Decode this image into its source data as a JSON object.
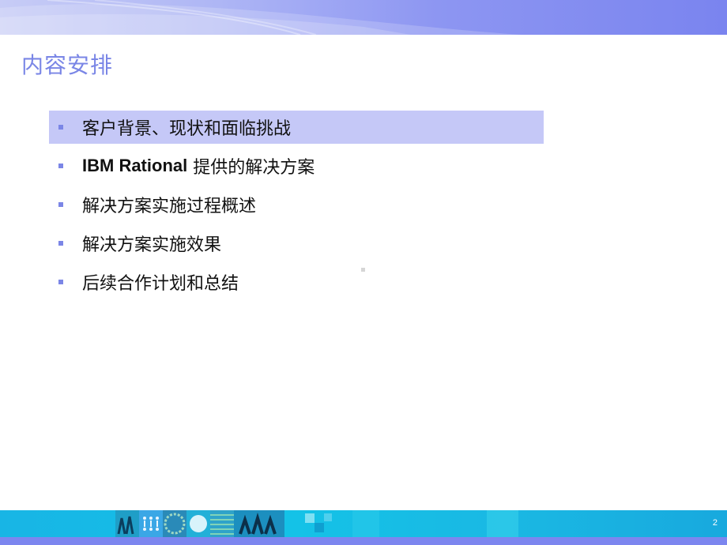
{
  "slide": {
    "title": "内容安排",
    "page_number": "2"
  },
  "agenda": {
    "items": [
      {
        "label": "客户背景、现状和面临挑战"
      },
      {
        "prefix": "IBM Rational",
        "label": " 提供的解决方案"
      },
      {
        "label": "解决方案实施过程概述"
      },
      {
        "label": "解决方案实施效果"
      },
      {
        "label": "后续合作计划和总结"
      }
    ]
  },
  "colors": {
    "header_band": "#8d96f2",
    "title_text": "#7a86e6",
    "active_item_background": "#c5c8f7",
    "bullet": "#7b86e6",
    "footer_band": "#14c2e7",
    "footer_strip": "#7c86ef"
  }
}
